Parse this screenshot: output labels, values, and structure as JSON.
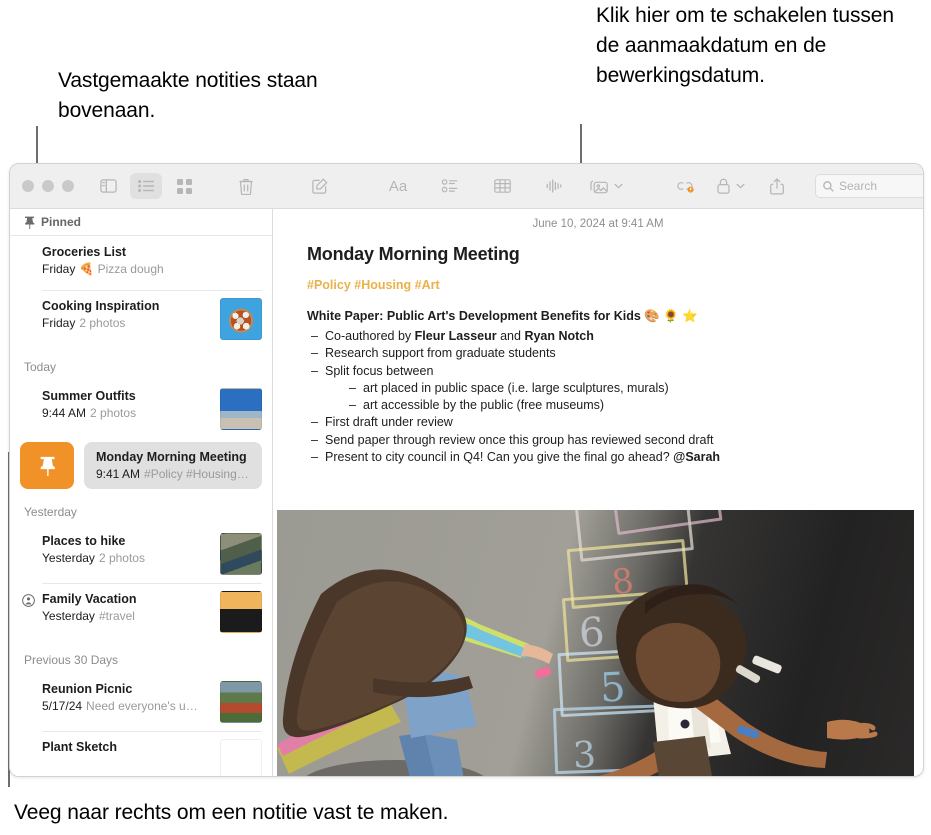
{
  "annotations": {
    "pinned": "Vastgemaakte notities staan bovenaan.",
    "date_toggle": "Klik hier om te schakelen tussen de aanmaakdatum en de bewerkingsdatum.",
    "swipe": "Veeg naar rechts om een notitie vast te maken."
  },
  "toolbar": {
    "sidebar_toggle": "sidebar-toggle",
    "list_view": "list-view",
    "gallery_view": "gallery-view",
    "delete": "delete",
    "compose": "compose",
    "format": "Aa",
    "checklist": "checklist",
    "table": "table",
    "audio": "audio",
    "media": "media",
    "collaborate": "collaborate",
    "lock": "lock",
    "share": "share",
    "search_placeholder": "Search",
    "accent_selected": "#e0e0e0"
  },
  "list": {
    "pinned_header": "Pinned",
    "groups": [
      {
        "label": "",
        "notes": [
          {
            "title": "Groceries List",
            "date": "Friday",
            "snippet": "🍕 Pizza dough",
            "thumb": "none",
            "shared": false
          },
          {
            "title": "Cooking Inspiration",
            "date": "Friday",
            "snippet": "2 photos",
            "thumb": "t-pizza",
            "shared": false
          }
        ]
      },
      {
        "label": "Today",
        "notes": [
          {
            "title": "Summer Outfits",
            "date": "9:44 AM",
            "snippet": "2 photos",
            "thumb": "t-beach",
            "shared": false
          }
        ]
      },
      {
        "label": "Yesterday",
        "notes": [
          {
            "title": "Places to hike",
            "date": "Yesterday",
            "snippet": "2 photos",
            "thumb": "t-hike",
            "shared": false
          },
          {
            "title": "Family Vacation",
            "date": "Yesterday",
            "snippet": "#travel",
            "thumb": "t-bike",
            "shared": true
          }
        ]
      },
      {
        "label": "Previous 30 Days",
        "notes": [
          {
            "title": "Reunion Picnic",
            "date": "5/17/24",
            "snippet": "Need everyone's u…",
            "thumb": "t-picnic",
            "shared": false
          },
          {
            "title": "Plant Sketch",
            "date": "",
            "snippet": "",
            "thumb": "t-plant",
            "shared": false
          }
        ]
      }
    ],
    "swipe_row": {
      "pin_label": "pin",
      "pin_color": "#f09227",
      "title": "Monday Morning Meeting",
      "date": "9:41 AM",
      "snippet": "#Policy #Housing…"
    }
  },
  "detail": {
    "date": "June 10, 2024 at 9:41 AM",
    "title": "Monday Morning Meeting",
    "tags": "#Policy #Housing #Art",
    "tags_color": "#eab149",
    "heading": "White Paper: Public Art's Development Benefits for Kids 🎨 🌻 ⭐",
    "bullets": [
      {
        "text_pre": "Co-authored by ",
        "bold1": "Fleur Lasseur",
        "mid": " and ",
        "bold2": "Ryan Notch",
        "text_post": ""
      },
      {
        "text_pre": "Research support from graduate students"
      },
      {
        "text_pre": "Split focus between",
        "children": [
          "art placed in public space (i.e. large sculptures, murals)",
          "art accessible by the public (free museums)"
        ]
      },
      {
        "text_pre": "First draft under review"
      },
      {
        "text_pre": "Send paper through review once this group has reviewed second draft"
      },
      {
        "text_pre": "Present to city council in Q4! Can you give the final go ahead? ",
        "bold1": "@Sarah"
      }
    ],
    "photo_alt": "children playing hopscotch on asphalt",
    "chalk_numbers": [
      "8",
      "6",
      "5",
      "3"
    ]
  }
}
